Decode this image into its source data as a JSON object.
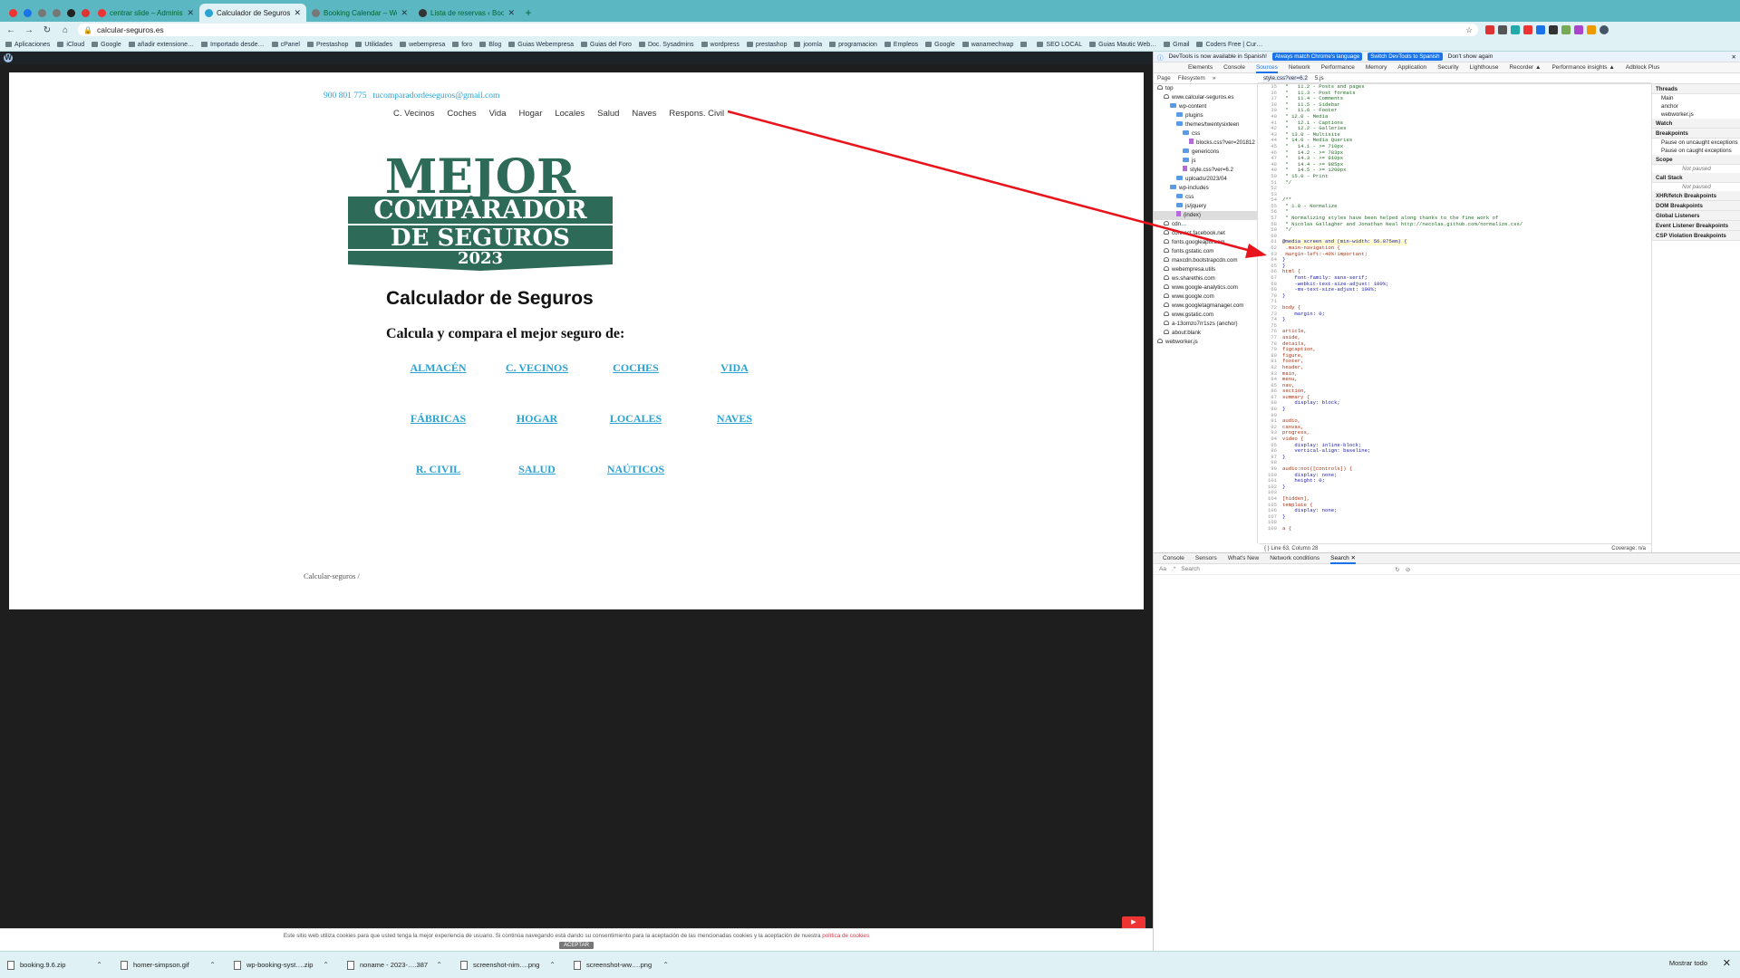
{
  "browser": {
    "tabs": [
      {
        "title": "",
        "color": "#e33"
      },
      {
        "title": "",
        "color": "#1a73e8"
      },
      {
        "title": "",
        "color": "#777"
      },
      {
        "title": "",
        "color": "#777"
      },
      {
        "title": "",
        "color": "#222"
      },
      {
        "title": "",
        "color": "#d33"
      },
      {
        "title": "centrar slide – Administració…",
        "color": "#e33"
      },
      {
        "title": "Calculador de Seguros - Calc…",
        "color": "#2aa3d4",
        "active": true
      },
      {
        "title": "Booking Calendar – WordPres…",
        "color": "#777"
      },
      {
        "title": "Lista de reservas ‹ Booking C…",
        "color": "#333"
      }
    ],
    "url": "calcular-seguros.es",
    "bookmarks": [
      "Aplicaciones",
      "iCloud",
      "Google",
      "añadir extensione…",
      "Importado desde…",
      "cPanel",
      "Prestashop",
      "Utilidades",
      "webempresa",
      "foro",
      "Blog",
      "Guias Webempresa",
      "Guias del Foro",
      "Doc. Sysadmins",
      "wordpress",
      "prestashop",
      "joomla",
      "programacion",
      "Empleos",
      "Google",
      "wanamechwap",
      "",
      "SEO LOCAL",
      "Guias Mautic Web…",
      "Gmail",
      "Coders Free | Cur…"
    ],
    "downloads": [
      "booking.9.6.zip",
      "homer-simpson.gif",
      "wp-booking-syst….zip",
      "noname - 2023-….387",
      "screenshot-nim….png",
      "screenshot-ww….png"
    ],
    "downloads_show_all": "Mostrar todo"
  },
  "site": {
    "phone": "900 801 775",
    "email": "tucomparadordeseguros@gmail.com",
    "nav": [
      "C. Vecinos",
      "Coches",
      "Vida",
      "Hogar",
      "Locales",
      "Salud",
      "Naves",
      "Respons. Civil"
    ],
    "logo": {
      "line1": "MEJOR",
      "line2": "COMPARADOR",
      "line3": "DE SEGUROS",
      "year": "2023",
      "color": "#2d6a58"
    },
    "title": "Calculador de Seguros",
    "subtitle": "Calcula y compara el mejor seguro de:",
    "links": [
      "ALMACÉN",
      "C. VECINOS",
      "COCHES",
      "VIDA",
      "FÁBRICAS",
      "HOGAR",
      "LOCALES",
      "NAVES",
      "R. CIVIL",
      "SALUD",
      "NAÚTICOS"
    ],
    "breadcrumb": "Calcular-seguros /",
    "cookie_text": "Este sitio web utiliza cookies para que usted tenga la mejor experiencia de usuario. Si continúa navegando está dando su consentimiento para la aceptación de las mencionadas cookies y la aceptación de nuestra ",
    "cookie_link": "política de cookies",
    "cookie_button": "ACEPTAR"
  },
  "devtools": {
    "info": "DevTools is now available in Spanish!",
    "btn_match": "Always match Chrome's language",
    "btn_switch": "Switch DevTools to Spanish",
    "dont_show": "Don't show again",
    "tabs": [
      "Elements",
      "Console",
      "Sources",
      "Network",
      "Performance",
      "Memory",
      "Application",
      "Security",
      "Lighthouse",
      "Recorder ▲",
      "Performance insights ▲",
      "Adblock Plus"
    ],
    "subtabs": [
      "Page",
      "Filesystem",
      "»"
    ],
    "open_files": [
      "style.css?ver=6.2",
      "5.js"
    ],
    "tree": [
      {
        "label": "top",
        "icon": "c",
        "indent": 0
      },
      {
        "label": "www.calcular-seguros.es",
        "icon": "c",
        "indent": 1
      },
      {
        "label": "wp-content",
        "icon": "d",
        "indent": 2
      },
      {
        "label": "plugins",
        "icon": "d",
        "indent": 3
      },
      {
        "label": "themes/twentysixteen",
        "icon": "d",
        "indent": 3
      },
      {
        "label": "css",
        "icon": "d",
        "indent": 4
      },
      {
        "label": "blocks.css?ver=201812",
        "icon": "f",
        "indent": 5
      },
      {
        "label": "genericons",
        "icon": "d",
        "indent": 4
      },
      {
        "label": "js",
        "icon": "d",
        "indent": 4
      },
      {
        "label": "style.css?ver=6.2",
        "icon": "f",
        "indent": 4
      },
      {
        "label": "uploads/2023/04",
        "icon": "d",
        "indent": 3
      },
      {
        "label": "wp-includes",
        "icon": "d",
        "indent": 2
      },
      {
        "label": "css",
        "icon": "d",
        "indent": 3
      },
      {
        "label": "js/jquery",
        "icon": "d",
        "indent": 3
      },
      {
        "label": "(index)",
        "icon": "f",
        "indent": 3
      },
      {
        "label": "cdn…",
        "icon": "c",
        "indent": 1
      },
      {
        "label": "connect.facebook.net",
        "icon": "c",
        "indent": 1
      },
      {
        "label": "fonts.googleapis.com",
        "icon": "c",
        "indent": 1
      },
      {
        "label": "fonts.gstatic.com",
        "icon": "c",
        "indent": 1
      },
      {
        "label": "maxcdn.bootstrapcdn.com",
        "icon": "c",
        "indent": 1
      },
      {
        "label": "webempresa.utils",
        "icon": "c",
        "indent": 1
      },
      {
        "label": "ws.sharethis.com",
        "icon": "c",
        "indent": 1
      },
      {
        "label": "www.google-analytics.com",
        "icon": "c",
        "indent": 1
      },
      {
        "label": "www.google.com",
        "icon": "c",
        "indent": 1
      },
      {
        "label": "www.googletagmanager.com",
        "icon": "c",
        "indent": 1
      },
      {
        "label": "www.gstatic.com",
        "icon": "c",
        "indent": 1
      },
      {
        "label": "a-13omzo7rr1szs (anchor)",
        "icon": "c",
        "indent": 1
      },
      {
        "label": "about:blank",
        "icon": "c",
        "indent": 1
      },
      {
        "label": "webworker.js",
        "icon": "c",
        "indent": 0
      }
    ],
    "code": [
      {
        "n": "35",
        "t": " *   11.2 - Posts and pages",
        "k": "cm"
      },
      {
        "n": "36",
        "t": " *   11.3 - Post formats",
        "k": "cm"
      },
      {
        "n": "37",
        "t": " *   11.4 - Comments",
        "k": "cm"
      },
      {
        "n": "38",
        "t": " *   11.5 - Sidebar",
        "k": "cm"
      },
      {
        "n": "39",
        "t": " *   11.6 - Footer",
        "k": "cm"
      },
      {
        "n": "40",
        "t": " * 12.0 - Media",
        "k": "cm"
      },
      {
        "n": "41",
        "t": " *   12.1 - Captions",
        "k": "cm"
      },
      {
        "n": "42",
        "t": " *   12.2 - Galleries",
        "k": "cm"
      },
      {
        "n": "43",
        "t": " * 13.0 - Multisite",
        "k": "cm"
      },
      {
        "n": "44",
        "t": " * 14.0 - Media Queries",
        "k": "cm"
      },
      {
        "n": "45",
        "t": " *   14.1 - >= 710px",
        "k": "cm"
      },
      {
        "n": "46",
        "t": " *   14.2 - >= 783px",
        "k": "cm"
      },
      {
        "n": "47",
        "t": " *   14.3 - >= 910px",
        "k": "cm"
      },
      {
        "n": "48",
        "t": " *   14.4 - >= 985px",
        "k": "cm"
      },
      {
        "n": "49",
        "t": " *   14.5 - >= 1200px",
        "k": "cm"
      },
      {
        "n": "50",
        "t": " * 15.0 - Print",
        "k": "cm"
      },
      {
        "n": "51",
        "t": " */",
        "k": "cm"
      },
      {
        "n": "52",
        "t": "",
        "k": ""
      },
      {
        "n": "53",
        "t": "",
        "k": ""
      },
      {
        "n": "54",
        "t": "/**",
        "k": "cm"
      },
      {
        "n": "55",
        "t": " * 1.0 - Normalize",
        "k": "cm"
      },
      {
        "n": "56",
        "t": " *",
        "k": "cm"
      },
      {
        "n": "57",
        "t": " * Normalizing styles have been helped along thanks to the fine work of",
        "k": "cm"
      },
      {
        "n": "58",
        "t": " * Nicolas Gallagher and Jonathan Neal http://necolas.github.com/normalize.css/",
        "k": "cm"
      },
      {
        "n": "59",
        "t": " */",
        "k": "cm"
      },
      {
        "n": "60",
        "t": "",
        "k": ""
      },
      {
        "n": "61",
        "t": "@media screen and (min-width: 56.875em) {",
        "k": "hl"
      },
      {
        "n": "62",
        "t": " .main-navigation {",
        "k": "at"
      },
      {
        "n": "63",
        "t": " margin-left:-40%!important;",
        "k": "at"
      },
      {
        "n": "64",
        "t": "}",
        "k": ""
      },
      {
        "n": "65",
        "t": "}",
        "k": ""
      },
      {
        "n": "66",
        "t": "html {",
        "k": "at"
      },
      {
        "n": "67",
        "t": "    font-family: sans-serif;",
        "k": ""
      },
      {
        "n": "68",
        "t": "    -webkit-text-size-adjust: 100%;",
        "k": ""
      },
      {
        "n": "69",
        "t": "    -ms-text-size-adjust: 100%;",
        "k": ""
      },
      {
        "n": "70",
        "t": "}",
        "k": ""
      },
      {
        "n": "71",
        "t": "",
        "k": ""
      },
      {
        "n": "72",
        "t": "body {",
        "k": "at"
      },
      {
        "n": "73",
        "t": "    margin: 0;",
        "k": ""
      },
      {
        "n": "74",
        "t": "}",
        "k": ""
      },
      {
        "n": "75",
        "t": "",
        "k": ""
      },
      {
        "n": "76",
        "t": "article,",
        "k": "at"
      },
      {
        "n": "77",
        "t": "aside,",
        "k": "at"
      },
      {
        "n": "78",
        "t": "details,",
        "k": "at"
      },
      {
        "n": "79",
        "t": "figcaption,",
        "k": "at"
      },
      {
        "n": "80",
        "t": "figure,",
        "k": "at"
      },
      {
        "n": "81",
        "t": "footer,",
        "k": "at"
      },
      {
        "n": "82",
        "t": "header,",
        "k": "at"
      },
      {
        "n": "83",
        "t": "main,",
        "k": "at"
      },
      {
        "n": "84",
        "t": "menu,",
        "k": "at"
      },
      {
        "n": "85",
        "t": "nav,",
        "k": "at"
      },
      {
        "n": "86",
        "t": "section,",
        "k": "at"
      },
      {
        "n": "87",
        "t": "summary {",
        "k": "at"
      },
      {
        "n": "88",
        "t": "    display: block;",
        "k": ""
      },
      {
        "n": "89",
        "t": "}",
        "k": ""
      },
      {
        "n": "90",
        "t": "",
        "k": ""
      },
      {
        "n": "91",
        "t": "audio,",
        "k": "at"
      },
      {
        "n": "92",
        "t": "canvas,",
        "k": "at"
      },
      {
        "n": "93",
        "t": "progress,",
        "k": "at"
      },
      {
        "n": "94",
        "t": "video {",
        "k": "at"
      },
      {
        "n": "95",
        "t": "    display: inline-block;",
        "k": ""
      },
      {
        "n": "96",
        "t": "    vertical-align: baseline;",
        "k": ""
      },
      {
        "n": "97",
        "t": "}",
        "k": ""
      },
      {
        "n": "98",
        "t": "",
        "k": ""
      },
      {
        "n": "99",
        "t": "audio:not([controls]) {",
        "k": "at"
      },
      {
        "n": "100",
        "t": "    display: none;",
        "k": ""
      },
      {
        "n": "101",
        "t": "    height: 0;",
        "k": ""
      },
      {
        "n": "102",
        "t": "}",
        "k": ""
      },
      {
        "n": "103",
        "t": "",
        "k": ""
      },
      {
        "n": "104",
        "t": "[hidden],",
        "k": "at"
      },
      {
        "n": "105",
        "t": "template {",
        "k": "at"
      },
      {
        "n": "106",
        "t": "    display: none;",
        "k": ""
      },
      {
        "n": "107",
        "t": "}",
        "k": ""
      },
      {
        "n": "108",
        "t": "",
        "k": ""
      },
      {
        "n": "109",
        "t": "a {",
        "k": "at"
      }
    ],
    "status_left": "{ }  Line 63, Column 28",
    "status_right": "Coverage: n/a",
    "side": [
      {
        "h": "Threads",
        "items": [
          "Main",
          "anchor",
          "webworker.js"
        ]
      },
      {
        "h": "Watch",
        "items": []
      },
      {
        "h": "Breakpoints",
        "items": [
          "Pause on uncaught exceptions",
          "Pause on caught exceptions"
        ]
      },
      {
        "h": "Scope",
        "items": [
          "Not paused"
        ]
      },
      {
        "h": "Call Stack",
        "items": [
          "Not paused"
        ]
      },
      {
        "h": "XHR/fetch Breakpoints",
        "items": []
      },
      {
        "h": "DOM Breakpoints",
        "items": []
      },
      {
        "h": "Global Listeners",
        "items": []
      },
      {
        "h": "Event Listener Breakpoints",
        "items": []
      },
      {
        "h": "CSP Violation Breakpoints",
        "items": []
      }
    ],
    "drawer_tabs": [
      "Console",
      "Sensors",
      "What's New",
      "Network conditions",
      "Search ✕"
    ],
    "search_placeholder": "Search",
    "search_aa": "Aa",
    "search_regex": ".*"
  },
  "annotation": {
    "color": "#e8131b"
  }
}
